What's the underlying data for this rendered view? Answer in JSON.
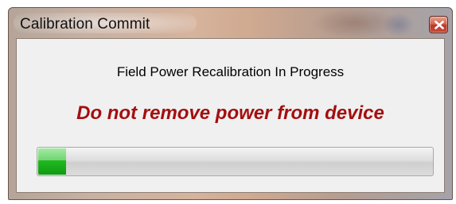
{
  "window": {
    "title": "Calibration Commit",
    "close_icon": "close-icon"
  },
  "dialog": {
    "message": "Field Power Recalibration In Progress",
    "warning": "Do not remove power from device"
  },
  "progress": {
    "fraction": 0.07
  },
  "colors": {
    "warning_text": "#a30f10",
    "progress_fill": "#1fb81f",
    "close_button": "#c94a37"
  }
}
